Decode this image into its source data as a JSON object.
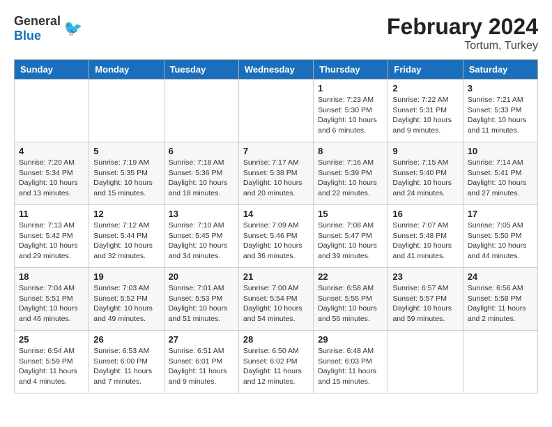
{
  "logo": {
    "general": "General",
    "blue": "Blue"
  },
  "title": "February 2024",
  "subtitle": "Tortum, Turkey",
  "days_of_week": [
    "Sunday",
    "Monday",
    "Tuesday",
    "Wednesday",
    "Thursday",
    "Friday",
    "Saturday"
  ],
  "weeks": [
    [
      {
        "day": "",
        "info": ""
      },
      {
        "day": "",
        "info": ""
      },
      {
        "day": "",
        "info": ""
      },
      {
        "day": "",
        "info": ""
      },
      {
        "day": "1",
        "info": "Sunrise: 7:23 AM\nSunset: 5:30 PM\nDaylight: 10 hours\nand 6 minutes."
      },
      {
        "day": "2",
        "info": "Sunrise: 7:22 AM\nSunset: 5:31 PM\nDaylight: 10 hours\nand 9 minutes."
      },
      {
        "day": "3",
        "info": "Sunrise: 7:21 AM\nSunset: 5:33 PM\nDaylight: 10 hours\nand 11 minutes."
      }
    ],
    [
      {
        "day": "4",
        "info": "Sunrise: 7:20 AM\nSunset: 5:34 PM\nDaylight: 10 hours\nand 13 minutes."
      },
      {
        "day": "5",
        "info": "Sunrise: 7:19 AM\nSunset: 5:35 PM\nDaylight: 10 hours\nand 15 minutes."
      },
      {
        "day": "6",
        "info": "Sunrise: 7:18 AM\nSunset: 5:36 PM\nDaylight: 10 hours\nand 18 minutes."
      },
      {
        "day": "7",
        "info": "Sunrise: 7:17 AM\nSunset: 5:38 PM\nDaylight: 10 hours\nand 20 minutes."
      },
      {
        "day": "8",
        "info": "Sunrise: 7:16 AM\nSunset: 5:39 PM\nDaylight: 10 hours\nand 22 minutes."
      },
      {
        "day": "9",
        "info": "Sunrise: 7:15 AM\nSunset: 5:40 PM\nDaylight: 10 hours\nand 24 minutes."
      },
      {
        "day": "10",
        "info": "Sunrise: 7:14 AM\nSunset: 5:41 PM\nDaylight: 10 hours\nand 27 minutes."
      }
    ],
    [
      {
        "day": "11",
        "info": "Sunrise: 7:13 AM\nSunset: 5:42 PM\nDaylight: 10 hours\nand 29 minutes."
      },
      {
        "day": "12",
        "info": "Sunrise: 7:12 AM\nSunset: 5:44 PM\nDaylight: 10 hours\nand 32 minutes."
      },
      {
        "day": "13",
        "info": "Sunrise: 7:10 AM\nSunset: 5:45 PM\nDaylight: 10 hours\nand 34 minutes."
      },
      {
        "day": "14",
        "info": "Sunrise: 7:09 AM\nSunset: 5:46 PM\nDaylight: 10 hours\nand 36 minutes."
      },
      {
        "day": "15",
        "info": "Sunrise: 7:08 AM\nSunset: 5:47 PM\nDaylight: 10 hours\nand 39 minutes."
      },
      {
        "day": "16",
        "info": "Sunrise: 7:07 AM\nSunset: 5:48 PM\nDaylight: 10 hours\nand 41 minutes."
      },
      {
        "day": "17",
        "info": "Sunrise: 7:05 AM\nSunset: 5:50 PM\nDaylight: 10 hours\nand 44 minutes."
      }
    ],
    [
      {
        "day": "18",
        "info": "Sunrise: 7:04 AM\nSunset: 5:51 PM\nDaylight: 10 hours\nand 46 minutes."
      },
      {
        "day": "19",
        "info": "Sunrise: 7:03 AM\nSunset: 5:52 PM\nDaylight: 10 hours\nand 49 minutes."
      },
      {
        "day": "20",
        "info": "Sunrise: 7:01 AM\nSunset: 5:53 PM\nDaylight: 10 hours\nand 51 minutes."
      },
      {
        "day": "21",
        "info": "Sunrise: 7:00 AM\nSunset: 5:54 PM\nDaylight: 10 hours\nand 54 minutes."
      },
      {
        "day": "22",
        "info": "Sunrise: 6:58 AM\nSunset: 5:55 PM\nDaylight: 10 hours\nand 56 minutes."
      },
      {
        "day": "23",
        "info": "Sunrise: 6:57 AM\nSunset: 5:57 PM\nDaylight: 10 hours\nand 59 minutes."
      },
      {
        "day": "24",
        "info": "Sunrise: 6:56 AM\nSunset: 5:58 PM\nDaylight: 11 hours\nand 2 minutes."
      }
    ],
    [
      {
        "day": "25",
        "info": "Sunrise: 6:54 AM\nSunset: 5:59 PM\nDaylight: 11 hours\nand 4 minutes."
      },
      {
        "day": "26",
        "info": "Sunrise: 6:53 AM\nSunset: 6:00 PM\nDaylight: 11 hours\nand 7 minutes."
      },
      {
        "day": "27",
        "info": "Sunrise: 6:51 AM\nSunset: 6:01 PM\nDaylight: 11 hours\nand 9 minutes."
      },
      {
        "day": "28",
        "info": "Sunrise: 6:50 AM\nSunset: 6:02 PM\nDaylight: 11 hours\nand 12 minutes."
      },
      {
        "day": "29",
        "info": "Sunrise: 6:48 AM\nSunset: 6:03 PM\nDaylight: 11 hours\nand 15 minutes."
      },
      {
        "day": "",
        "info": ""
      },
      {
        "day": "",
        "info": ""
      }
    ]
  ]
}
